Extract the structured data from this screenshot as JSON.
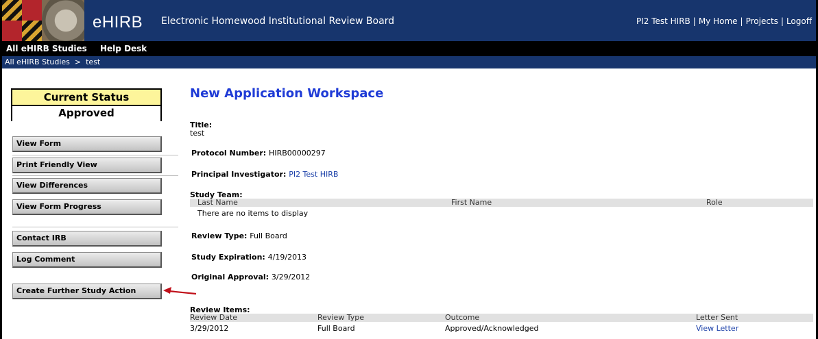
{
  "header": {
    "app_name": "eHIRB",
    "app_subtitle": "Electronic Homewood Institutional Review Board",
    "user_link": "PI2 Test HIRB",
    "links": [
      "My Home",
      "Projects",
      "Logoff"
    ],
    "brand_color": "#17356d"
  },
  "menu": {
    "items": [
      "All eHIRB Studies",
      "Help Desk"
    ]
  },
  "breadcrumb": {
    "text": "All eHIRB Studies  >  test"
  },
  "sidebar": {
    "status_heading": "Current Status",
    "status_value": "Approved",
    "buttons": [
      "View Form",
      "Print Friendly View",
      "View Differences",
      "View Form Progress",
      "Contact IRB",
      "Log Comment",
      "Create Further Study Action"
    ]
  },
  "main": {
    "workspace_title": "New Application Workspace",
    "title_label": "Title:",
    "title_value": "test",
    "protocol_label": "Protocol Number:",
    "protocol_value": "HIRB00000297",
    "pi_label": "Principal Investigator:",
    "pi_value": "PI2 Test HIRB",
    "study_team": {
      "label": "Study Team:",
      "columns": [
        "Last Name",
        "First Name",
        "Role"
      ],
      "empty_text": "There are no items to display"
    },
    "review_type_label": "Review Type:",
    "review_type_value": "Full Board",
    "expiration_label": "Study Expiration:",
    "expiration_value": "4/19/2013",
    "original_approval_label": "Original Approval:",
    "original_approval_value": "3/29/2012",
    "review_items": {
      "label": "Review Items:",
      "columns": [
        "Review Date",
        "Review Type",
        "Outcome",
        "Letter Sent"
      ],
      "rows": [
        [
          "3/29/2012",
          "Full Board",
          "Approved/Acknowledged",
          "View Letter"
        ]
      ]
    }
  }
}
